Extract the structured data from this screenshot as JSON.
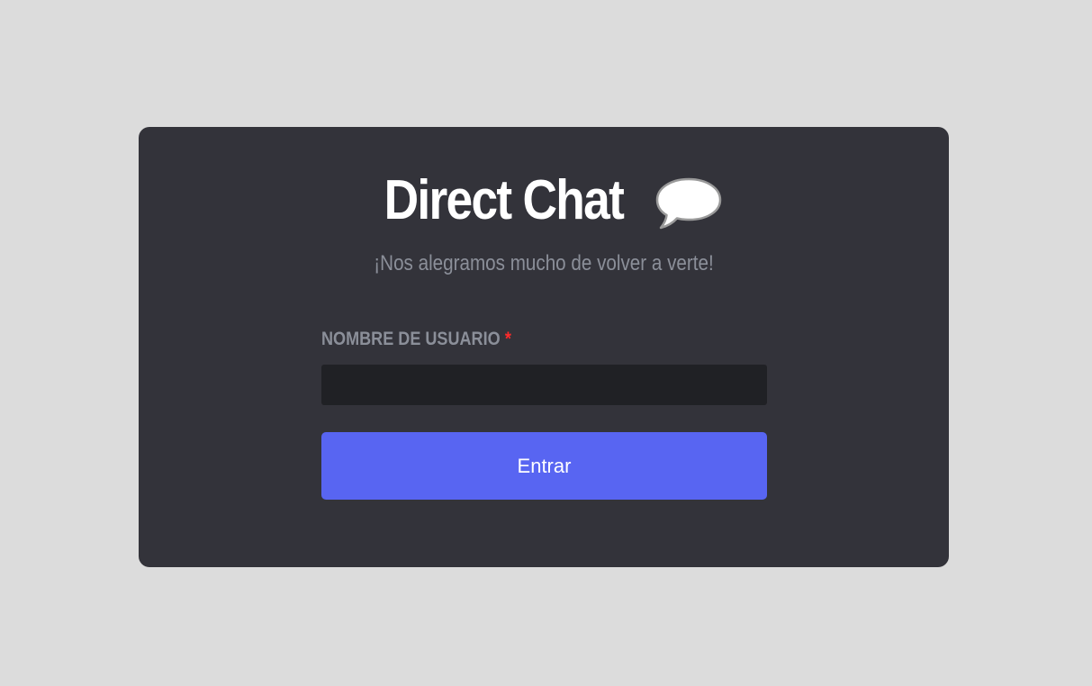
{
  "login": {
    "title": "Direct Chat",
    "title_icon": "speech-bubble-icon",
    "subtitle": "¡Nos alegramos mucho de volver a verte!",
    "username_label": "NOMBRE DE USUARIO",
    "required_marker": "*",
    "username_value": "",
    "submit_label": "Entrar"
  },
  "colors": {
    "background": "#dcdcdc",
    "card": "#33333a",
    "input": "#202125",
    "accent": "#5865f2",
    "muted_text": "#8b8f99",
    "required": "#ff2a2a"
  }
}
